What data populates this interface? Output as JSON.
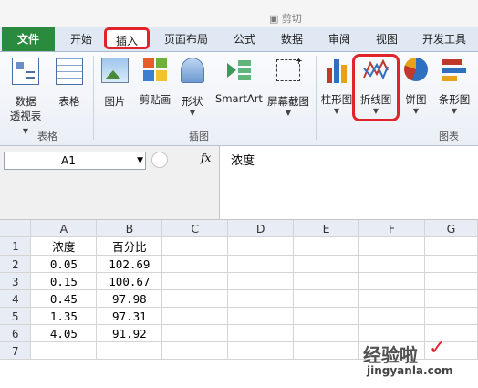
{
  "ribbon_tabs": [
    "文件",
    "开始",
    "插入",
    "页面布局",
    "公式",
    "数据",
    "审阅",
    "视图",
    "开发工具"
  ],
  "ribbon": {
    "pivot_label_1": "数据",
    "pivot_label_2": "透视表",
    "table_label": "表格",
    "picture_label": "图片",
    "clipart_label": "剪贴画",
    "shapes_label": "形状",
    "smartart_label": "SmartArt",
    "screenshot_label": "屏幕截图",
    "column_label": "柱形图",
    "line_label": "折线图",
    "pie_label": "饼图",
    "bar_label": "条形图",
    "group_tables": "表格",
    "group_illustrations": "插图",
    "group_charts": "图表"
  },
  "formula_bar": {
    "name_box": "A1",
    "fx": "fx",
    "formula": "浓度"
  },
  "sheet": {
    "columns": [
      "A",
      "B",
      "C",
      "D",
      "E",
      "F",
      "G"
    ],
    "rows": [
      [
        "1",
        "浓度",
        "百分比"
      ],
      [
        "2",
        "0.05",
        "102.69"
      ],
      [
        "3",
        "0.15",
        "100.67"
      ],
      [
        "4",
        "0.45",
        "97.98"
      ],
      [
        "5",
        "1.35",
        "97.31"
      ],
      [
        "6",
        "4.05",
        "91.92"
      ],
      [
        "7",
        "",
        ""
      ]
    ]
  },
  "watermark": {
    "line1": "经验啦",
    "line2": "jingyanla.com"
  },
  "colors": {
    "file_tab": "#2a8a3e",
    "highlight": "#e0242c",
    "header_bg": "#e8edf5"
  }
}
